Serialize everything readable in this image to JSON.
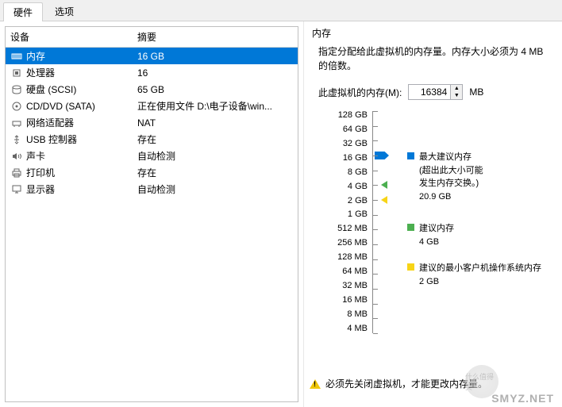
{
  "tabs": {
    "hardware": "硬件",
    "options": "选项"
  },
  "columns": {
    "device": "设备",
    "summary": "摘要"
  },
  "devices": [
    {
      "name": "内存",
      "summary": "16 GB",
      "icon": "memory",
      "selected": true
    },
    {
      "name": "处理器",
      "summary": "16",
      "icon": "cpu"
    },
    {
      "name": "硬盘 (SCSI)",
      "summary": "65 GB",
      "icon": "disk"
    },
    {
      "name": "CD/DVD (SATA)",
      "summary": "正在使用文件 D:\\电子设备\\win...",
      "icon": "cd"
    },
    {
      "name": "网络适配器",
      "summary": "NAT",
      "icon": "network"
    },
    {
      "name": "USB 控制器",
      "summary": "存在",
      "icon": "usb"
    },
    {
      "name": "声卡",
      "summary": "自动检测",
      "icon": "sound"
    },
    {
      "name": "打印机",
      "summary": "存在",
      "icon": "printer"
    },
    {
      "name": "显示器",
      "summary": "自动检测",
      "icon": "monitor"
    }
  ],
  "memory": {
    "title": "内存",
    "desc": "指定分配给此虚拟机的内存量。内存大小必须为 4 MB 的倍数。",
    "input_label": "此虚拟机的内存(M):",
    "value": "16384",
    "unit": "MB",
    "ticks": [
      "128 GB",
      "64 GB",
      "32 GB",
      "16 GB",
      "8 GB",
      "4 GB",
      "2 GB",
      "1 GB",
      "512 MB",
      "256 MB",
      "128 MB",
      "64 MB",
      "32 MB",
      "16 MB",
      "8 MB",
      "4 MB"
    ],
    "legends": {
      "max_title": "最大建议内存",
      "max_note1": "(超出此大小可能",
      "max_note2": "发生内存交换。)",
      "max_value": "20.9 GB",
      "rec_title": "建议内存",
      "rec_value": "4 GB",
      "min_title": "建议的最小客户机操作系统内存",
      "min_value": "2 GB"
    },
    "warning": "必须先关闭虚拟机，才能更改内存量。"
  },
  "watermark": "SMYZ.NET",
  "watermark_badge": "什么值得买"
}
